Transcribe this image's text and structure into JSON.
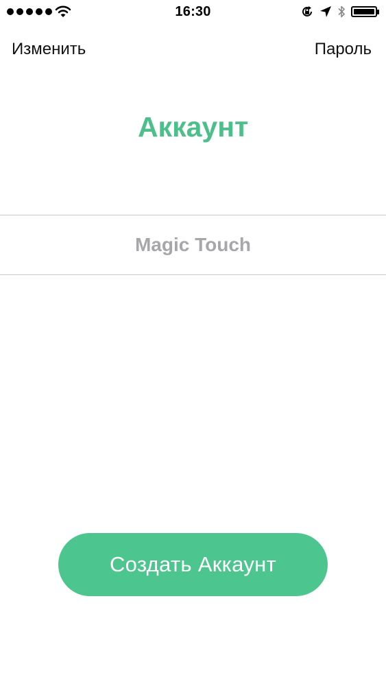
{
  "status_bar": {
    "time": "16:30",
    "signal_dots": 5,
    "icons": [
      "wifi-icon",
      "rotation-lock-icon",
      "location-arrow-icon",
      "bluetooth-icon",
      "battery-icon"
    ],
    "battery_level": 1.0
  },
  "nav": {
    "left_label": "Изменить",
    "right_label": "Пароль"
  },
  "title": "Аккаунт",
  "account": {
    "name": "Magic Touch"
  },
  "create_button": {
    "label": "Создать Аккаунт"
  },
  "colors": {
    "accent": "#4dbf8a",
    "button": "#4dc58f",
    "account_text": "#a6a6ab",
    "divider": "#c8c8cc"
  }
}
